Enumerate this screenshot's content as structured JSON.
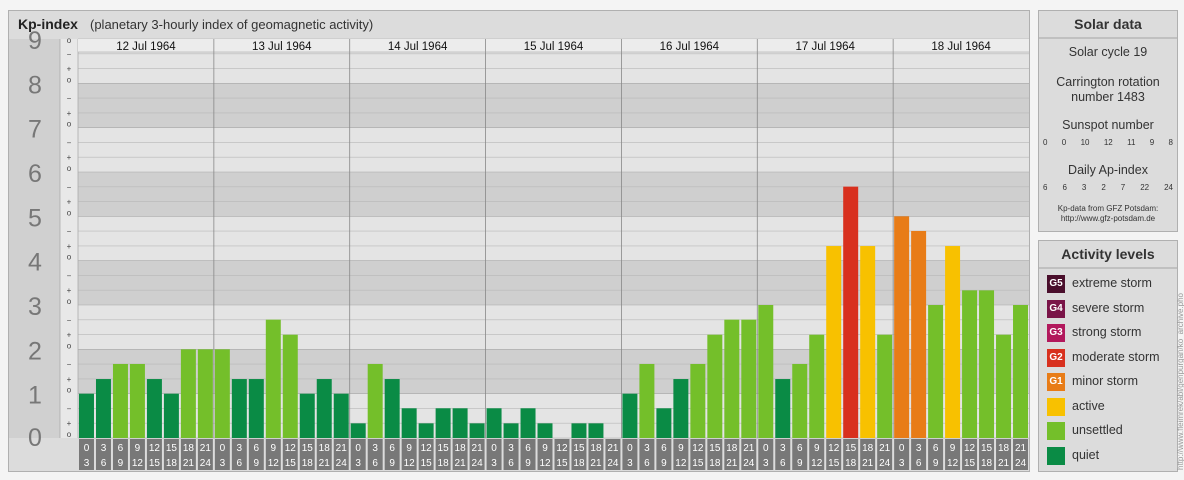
{
  "header": {
    "title": "Kp-index",
    "subtitle": "(planetary 3-hourly index of geomagnetic activity)"
  },
  "chart_data": {
    "type": "bar",
    "title": "Kp-index",
    "subtitle": "(planetary 3-hourly index of geomagnetic activity)",
    "ylim": [
      0,
      9
    ],
    "y_ticks": [
      "0",
      "1",
      "2",
      "3",
      "4",
      "5",
      "6",
      "7",
      "8",
      "9"
    ],
    "minor_tick_labels": [
      "o",
      "+",
      "−"
    ],
    "days": [
      "12 Jul 1964",
      "13 Jul 1964",
      "14 Jul 1964",
      "15 Jul 1964",
      "16 Jul 1964",
      "17 Jul 1964",
      "18 Jul 1964"
    ],
    "interval_top_labels": [
      "0",
      "3",
      "6",
      "9",
      "12",
      "15",
      "18",
      "21"
    ],
    "interval_bottom_labels": [
      "3",
      "6",
      "9",
      "12",
      "15",
      "18",
      "21",
      "24"
    ],
    "values": [
      [
        1.0,
        1.33,
        1.67,
        1.67,
        1.33,
        1.0,
        2.0,
        2.0
      ],
      [
        2.0,
        1.33,
        1.33,
        2.67,
        2.33,
        1.0,
        1.33,
        1.0
      ],
      [
        0.33,
        1.67,
        1.33,
        0.67,
        0.33,
        0.67,
        0.67,
        0.33
      ],
      [
        0.67,
        0.33,
        0.67,
        0.33,
        0.0,
        0.33,
        0.33,
        0.0
      ],
      [
        1.0,
        1.67,
        0.67,
        1.33,
        1.67,
        2.33,
        2.67,
        2.67
      ],
      [
        3.0,
        1.33,
        1.67,
        2.33,
        4.33,
        5.67,
        4.33,
        2.33
      ],
      [
        5.0,
        4.67,
        3.0,
        4.33,
        3.33,
        3.33,
        2.33,
        3.0
      ]
    ],
    "grid": true
  },
  "solar": {
    "title": "Solar data",
    "cycle": "Solar cycle 19",
    "carrington_line1": "Carrington rotation",
    "carrington_line2": "number 1483",
    "sunspot_title": "Sunspot number",
    "sunspot_values": [
      "0",
      "0",
      "10",
      "12",
      "11",
      "9",
      "8"
    ],
    "ap_title": "Daily Ap-index",
    "ap_values": [
      "6",
      "6",
      "3",
      "2",
      "7",
      "22",
      "24"
    ],
    "credit_line1": "Kp-data from GFZ Potsdam:",
    "credit_line2": "http://www.gfz-potsdam.de"
  },
  "activity": {
    "title": "Activity levels",
    "levels": [
      {
        "code": "G5",
        "label": "extreme storm",
        "color": "#4a0f2c"
      },
      {
        "code": "G4",
        "label": "severe storm",
        "color": "#7a1448"
      },
      {
        "code": "G3",
        "label": "strong storm",
        "color": "#b2185c"
      },
      {
        "code": "G2",
        "label": "moderate storm",
        "color": "#d8301e"
      },
      {
        "code": "G1",
        "label": "minor storm",
        "color": "#e87c17"
      },
      {
        "code": "",
        "label": "active",
        "color": "#f8c100"
      },
      {
        "code": "",
        "label": "unsettled",
        "color": "#74bf2a"
      },
      {
        "code": "",
        "label": "quiet",
        "color": "#0a8b45"
      }
    ]
  },
  "watermark": "http://www.fleimrek/abl/genpurgan/ko_archive.pho"
}
